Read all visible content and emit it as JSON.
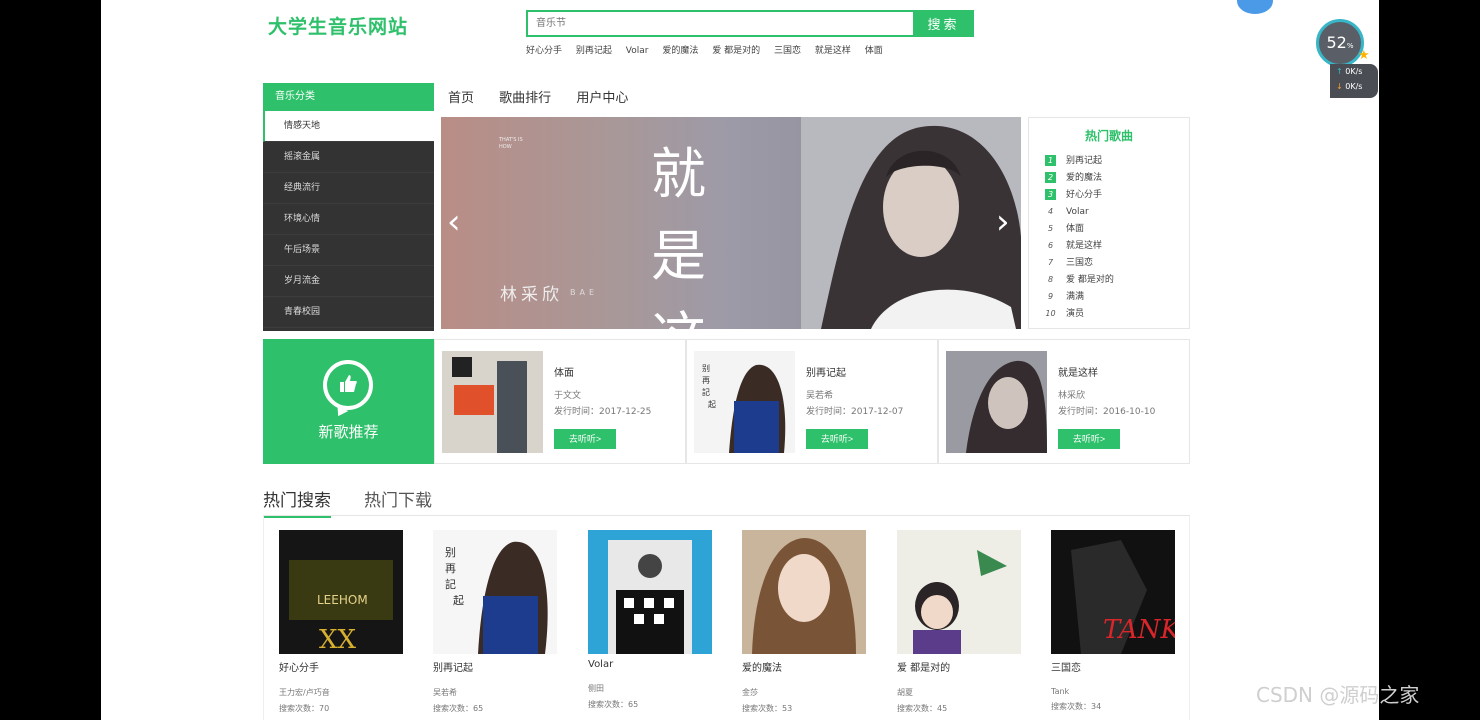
{
  "header": {
    "logo": "大学生音乐网站",
    "search_placeholder": "音乐节",
    "search_button": "搜索",
    "hot_words": [
      "好心分手",
      "别再记起",
      "Volar",
      "爱的魔法",
      "爱 都是对的",
      "三国恋",
      "就是这样",
      "体面"
    ]
  },
  "categories": {
    "title": "音乐分类",
    "items": [
      "情感天地",
      "摇滚金属",
      "经典流行",
      "环境心情",
      "午后场景",
      "岁月流金",
      "青春校园"
    ]
  },
  "nav": [
    "首页",
    "歌曲排行",
    "用户中心"
  ],
  "banner": {
    "tag": "THAT'S IS HOW",
    "title": "就是这样",
    "artist": "林采欣",
    "artist_en": "BAE",
    "prev": "‹",
    "next": "›"
  },
  "hot_songs": {
    "title": "热门歌曲",
    "items": [
      {
        "num": "1",
        "name": "别再记起"
      },
      {
        "num": "2",
        "name": "爱的魔法"
      },
      {
        "num": "3",
        "name": "好心分手"
      },
      {
        "num": "4",
        "name": "Volar"
      },
      {
        "num": "5",
        "name": "体面"
      },
      {
        "num": "6",
        "name": "就是这样"
      },
      {
        "num": "7",
        "name": "三国恋"
      },
      {
        "num": "8",
        "name": "爱 都是对的"
      },
      {
        "num": "9",
        "name": "满满"
      },
      {
        "num": "10",
        "name": "演员"
      }
    ]
  },
  "new_songs": {
    "label": "新歌推荐",
    "items": [
      {
        "name": "体面",
        "artist": "于文文",
        "date": "发行时间：2017-12-25",
        "button": "去听听>"
      },
      {
        "name": "别再记起",
        "artist": "吴若希",
        "date": "发行时间：2017-12-07",
        "button": "去听听>"
      },
      {
        "name": "就是这样",
        "artist": "林采欣",
        "date": "发行时间：2016-10-10",
        "button": "去听听>"
      }
    ]
  },
  "tabs": [
    "热门搜索",
    "热门下载"
  ],
  "hot_search": [
    {
      "name": "好心分手",
      "artist": "王力宏/卢巧音",
      "count": "搜索次数：70"
    },
    {
      "name": "别再记起",
      "artist": "吴若希",
      "count": "搜索次数：65"
    },
    {
      "name": "Volar",
      "artist": "侧田",
      "count": "搜索次数：65"
    },
    {
      "name": "爱的魔法",
      "artist": "金莎",
      "count": "搜索次数：53"
    },
    {
      "name": "爱 都是对的",
      "artist": "胡夏",
      "count": "搜索次数：45"
    },
    {
      "name": "三国恋",
      "artist": "Tank",
      "count": "搜索次数：34"
    }
  ],
  "overlay": {
    "speed_value": "52",
    "speed_unit": "%",
    "upload": "0K/s",
    "download": "0K/s",
    "watermark": "CSDN @源码之家"
  },
  "colors": {
    "accent": "#2ec06a",
    "sidebar_bg": "#333333"
  }
}
